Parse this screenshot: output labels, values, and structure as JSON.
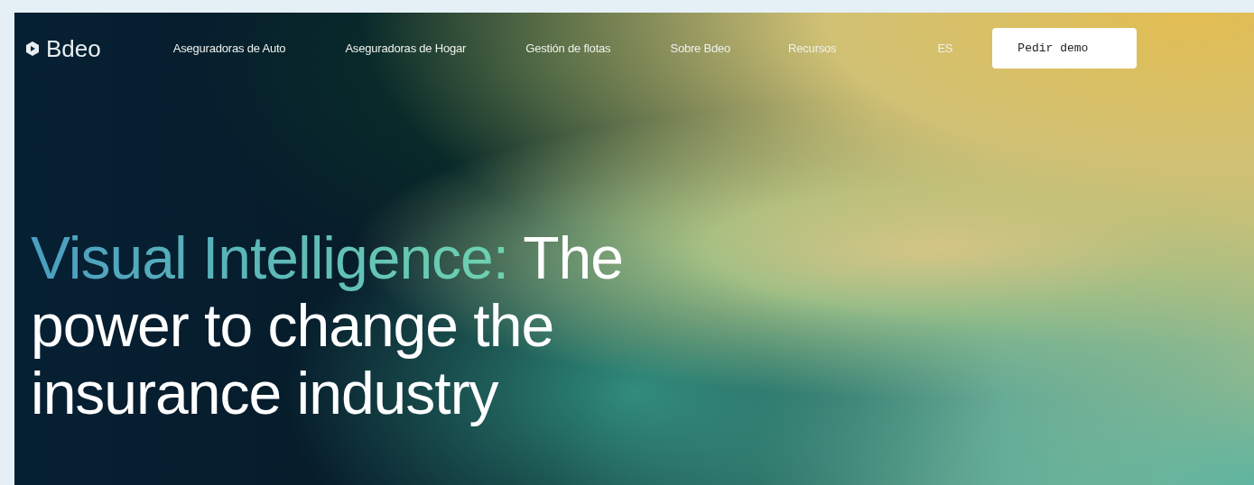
{
  "logo": {
    "text": "Bdeo"
  },
  "nav": {
    "items": [
      "Aseguradoras de Auto",
      "Aseguradoras de Hogar",
      "Gestión de flotas",
      "Sobre Bdeo",
      "Recursos",
      "ES"
    ],
    "button": "Pedir demo"
  },
  "hero": {
    "highlight": "Visual Intelligence:",
    "lines": [
      "The",
      "power to change the",
      "insurance industry"
    ]
  }
}
